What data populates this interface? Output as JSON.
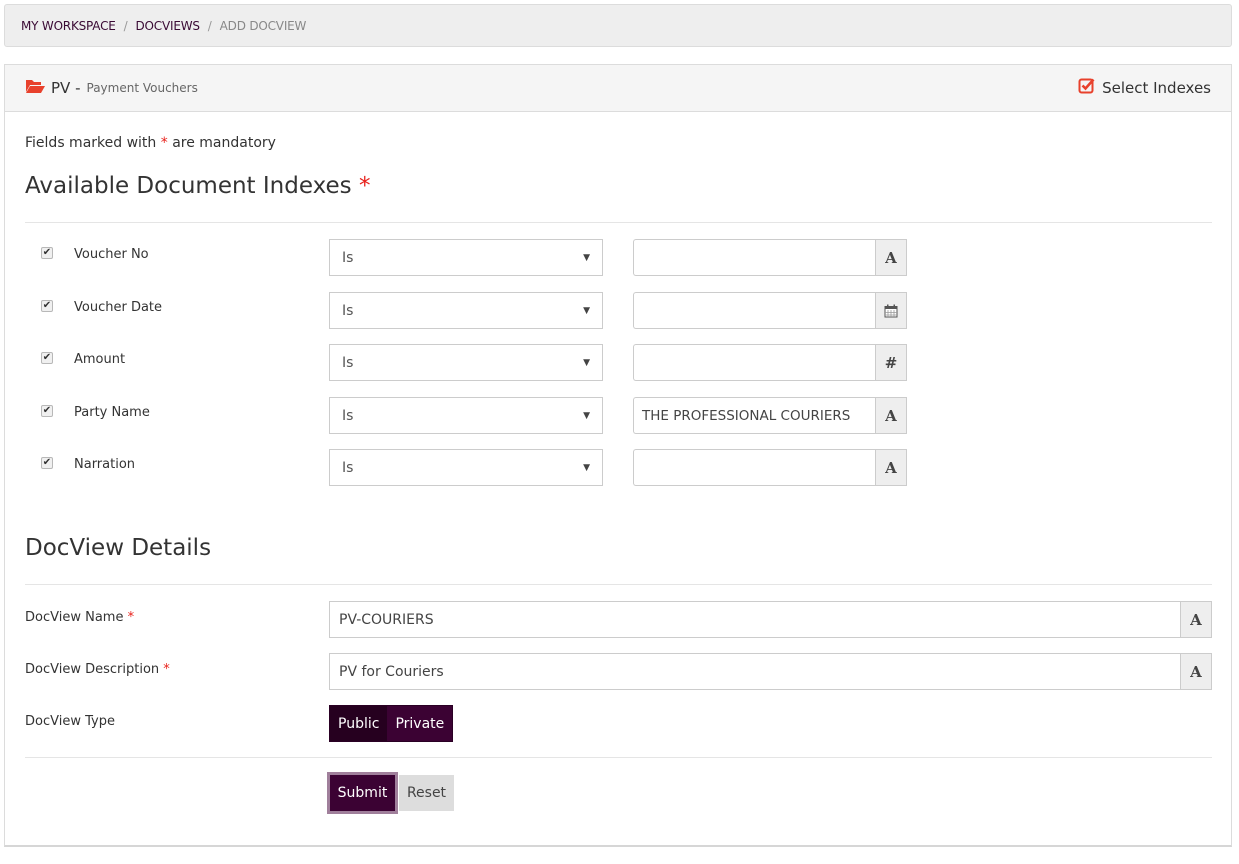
{
  "breadcrumb": [
    {
      "label": "MY WORKSPACE",
      "active": false
    },
    {
      "label": "DOCVIEWS",
      "active": false
    },
    {
      "label": "ADD DOCVIEW",
      "active": true
    }
  ],
  "breadcrumb_separator": "/",
  "panel": {
    "icon": "folder-open-icon",
    "code": "PV -",
    "subtitle": "Payment Vouchers",
    "select_indexes_label": "Select Indexes",
    "select_indexes_icon": "check-square-icon"
  },
  "form": {
    "mandatory_note_prefix": "Fields marked with",
    "mandatory_note_star": "*",
    "mandatory_note_suffix": "are mandatory",
    "indexes_heading": "Available Document Indexes",
    "indexes": [
      {
        "label": "Voucher No",
        "checked": true,
        "operator": "Is",
        "value": "",
        "addon_icon": "text-type-icon",
        "addon_glyph": "A"
      },
      {
        "label": "Voucher Date",
        "checked": true,
        "operator": "Is",
        "value": "",
        "addon_icon": "calendar-icon",
        "addon_glyph": ""
      },
      {
        "label": "Amount",
        "checked": true,
        "operator": "Is",
        "value": "",
        "addon_icon": "number-type-icon",
        "addon_glyph": "#"
      },
      {
        "label": "Party Name",
        "checked": true,
        "operator": "Is",
        "value": "THE PROFESSIONAL COURIERS",
        "addon_icon": "text-type-icon",
        "addon_glyph": "A"
      },
      {
        "label": "Narration",
        "checked": true,
        "operator": "Is",
        "value": "",
        "addon_icon": "text-type-icon",
        "addon_glyph": "A"
      }
    ],
    "details_heading": "DocView Details",
    "docview_name_label": "DocView Name",
    "docview_name_value": "PV-COURIERS",
    "docview_description_label": "DocView Description",
    "docview_description_value": "PV for Couriers",
    "docview_type_label": "DocView Type",
    "docview_type_options": [
      "Public",
      "Private"
    ],
    "docview_type_selected": "Public",
    "submit_label": "Submit",
    "reset_label": "Reset",
    "addon_glyph": "A"
  },
  "colors": {
    "accent": "#3b0233",
    "required": "#e8201a",
    "icon_red": "#e8412c"
  }
}
